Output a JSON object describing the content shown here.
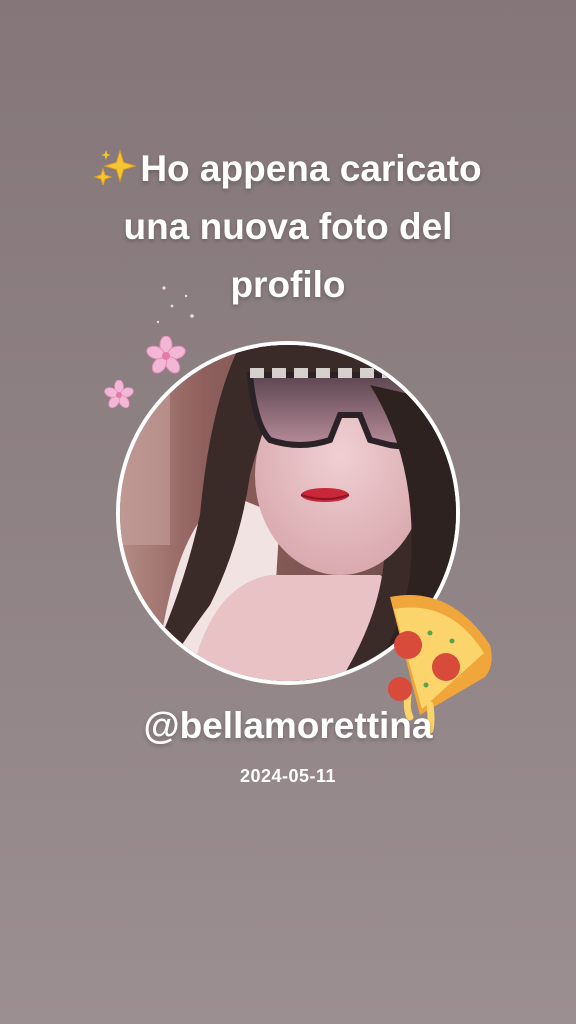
{
  "headline": {
    "sparkle_icon": "sparkles-icon",
    "line1": "Ho appena caricato",
    "line2": "una nuova foto del",
    "line3": "profilo"
  },
  "profile": {
    "username": "@bellamorettina",
    "date": "2024-05-11",
    "avatar": "profile-photo"
  },
  "stickers": [
    "cherry-blossom-icon",
    "cherry-blossom-icon",
    "pizza-slice-icon"
  ],
  "colors": {
    "background_top": "#857779",
    "background_bottom": "#9c8f91",
    "text": "#ffffff",
    "avatar_border": "#ffffff"
  }
}
